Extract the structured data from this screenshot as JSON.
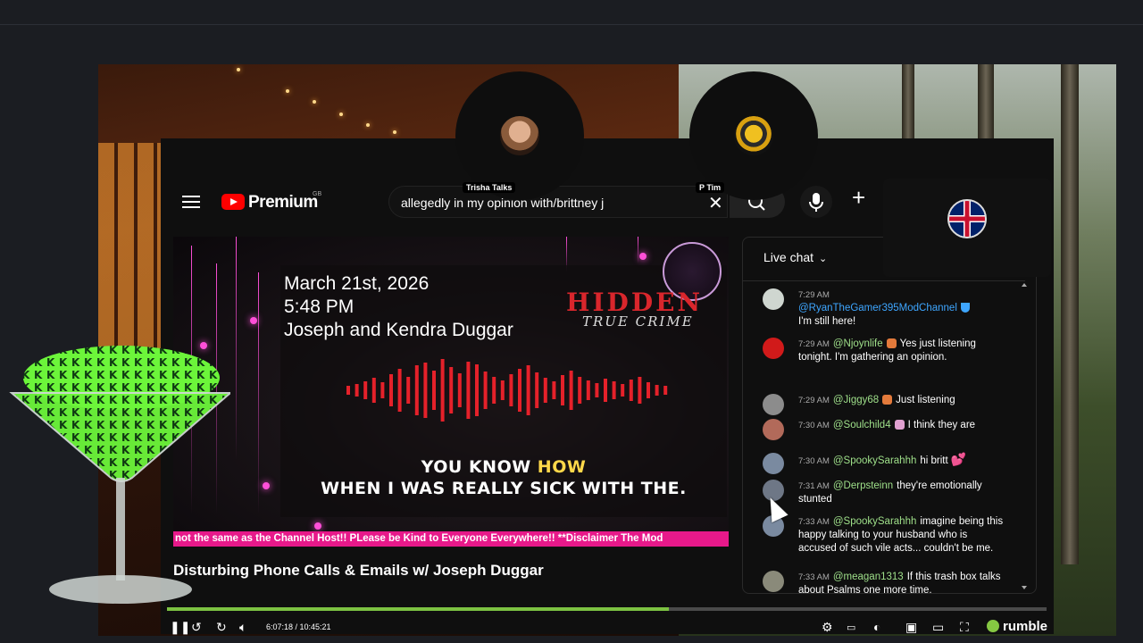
{
  "header": {
    "brand": "Premium",
    "region": "GB",
    "search_value": "allegedly in my opinion with/brittney j"
  },
  "participants": [
    {
      "name": "Trisha Talks"
    },
    {
      "name": "P Tim"
    }
  ],
  "video": {
    "date_line": "March 21st, 2026",
    "time_line": "5:48 PM",
    "subject_line": "Joseph and Kendra Duggar",
    "logo_main": "HIDDEN",
    "logo_sub": "TRUE CRIME",
    "caption_pre": "YOU KNOW ",
    "caption_highlight": "HOW",
    "caption_line2": "WHEN I WAS REALLY SICK WITH THE.",
    "ticker": "not the same as the Channel Host!! PLease be Kind to Everyone Everywhere!! **Disclaimer The Mod",
    "title": "Disturbing Phone Calls & Emails w/ Joseph Duggar"
  },
  "chat": {
    "header": "Live chat",
    "messages": [
      {
        "time": "7:29 AM",
        "author": "@RyanTheGamer395ModChannel",
        "text": "I'm still here!",
        "avatar_color": "#cfd6d0"
      },
      {
        "time": "7:29 AM",
        "author": "@Njoynlife",
        "text": "Yes just listening tonight. I'm gathering an opinion.",
        "avatar_color": "#d11a1a"
      },
      {
        "time": "7:29 AM",
        "author": "@Jiggy68",
        "text": "Just listening",
        "avatar_color": "#8c8c8c"
      },
      {
        "time": "7:30 AM",
        "author": "@Soulchild4",
        "text": "I think they are",
        "avatar_color": "#b26a5a"
      },
      {
        "time": "7:30 AM",
        "author": "@SpookySarahhh",
        "text": "hi britt",
        "avatar_color": "#7a8aa0"
      },
      {
        "time": "7:31 AM",
        "author": "@Derpsteinn",
        "text": "they're emotionally stunted",
        "avatar_color": "#6e7786"
      },
      {
        "time": "7:33 AM",
        "author": "@SpookySarahhh",
        "text": "imagine being this happy talking to your husband who is accused of such vile acts... couldn't be me.",
        "avatar_color": "#7a8aa0"
      },
      {
        "time": "7:33 AM",
        "author": "@meagan1313",
        "text": "If this trash box talks about Psalms one more time,",
        "avatar_color": "#8a8a7a"
      }
    ]
  },
  "player": {
    "time": "6:07:18 / 10:45:21",
    "progress_fraction": 0.571,
    "brand": "rumble"
  }
}
